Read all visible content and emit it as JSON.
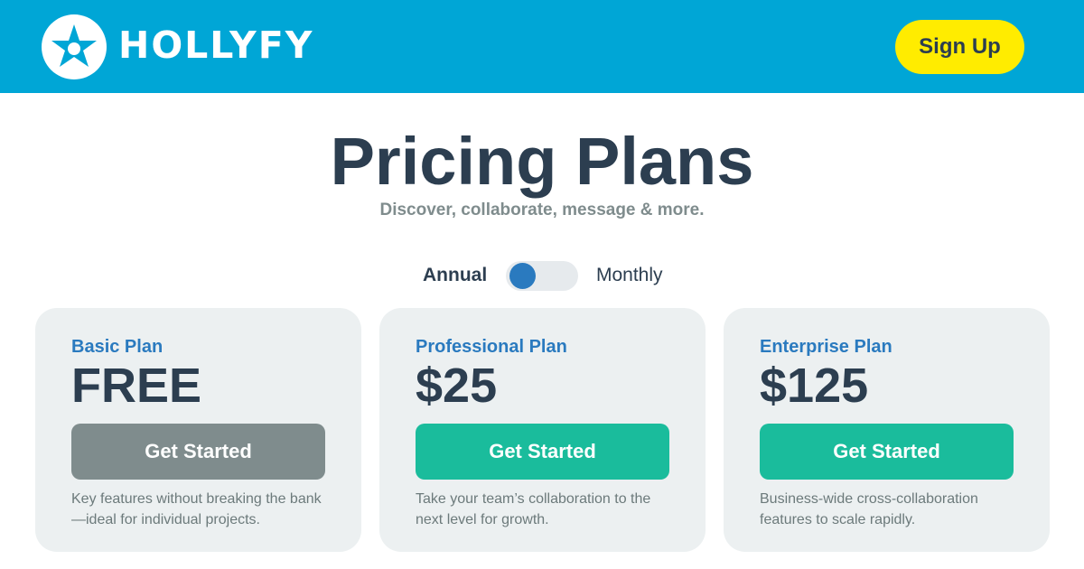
{
  "header": {
    "brand": "HOLLYFY",
    "logo_icon": "star-icon",
    "signup_label": "Sign Up"
  },
  "hero": {
    "title": "Pricing Plans",
    "subtitle": "Discover, collaborate, message & more."
  },
  "billing_toggle": {
    "left_label": "Annual",
    "right_label": "Monthly",
    "selected": "Annual"
  },
  "plans": [
    {
      "name": "Basic Plan",
      "price": "FREE",
      "cta": "Get Started",
      "description": "Key features without breaking the bank—ideal for individual projects."
    },
    {
      "name": "Professional Plan",
      "price": "$25",
      "cta": "Get Started",
      "description": "Take your team’s collaboration to the next level for growth."
    },
    {
      "name": "Enterprise Plan",
      "price": "$125",
      "cta": "Get Started",
      "description": "Business-wide cross-collaboration features to scale rapidly."
    }
  ],
  "colors": {
    "header_bg": "#00a6d6",
    "signup_bg": "#ffec00",
    "text_dark": "#2c3e50",
    "accent_blue": "#2a7abf",
    "cta_teal": "#1abc9c",
    "cta_gray": "#7f8c8d",
    "card_bg": "#ecf0f1"
  }
}
